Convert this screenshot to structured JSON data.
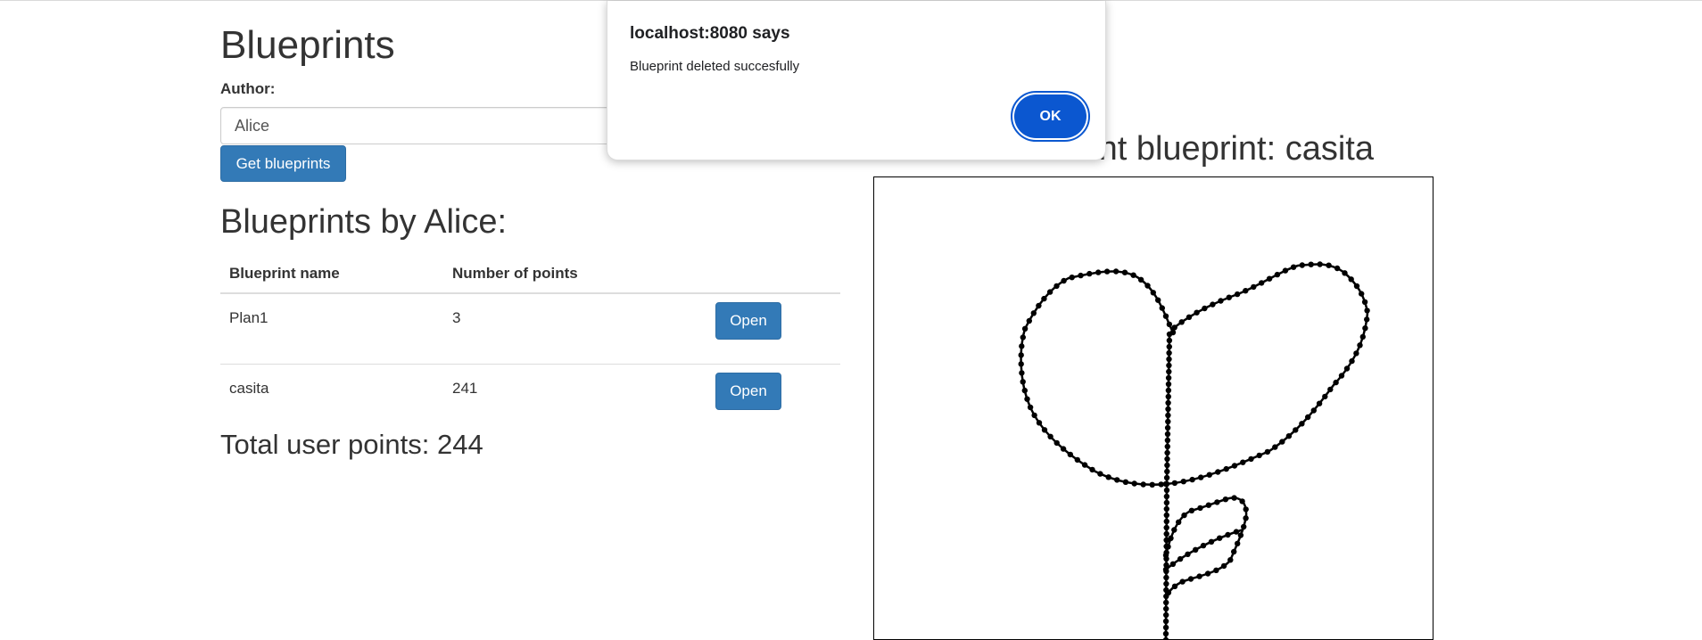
{
  "page": {
    "title": "Blueprints"
  },
  "author": {
    "label": "Author:",
    "value": "Alice"
  },
  "get_button": {
    "label": "Get blueprints"
  },
  "section": {
    "title": "Blueprints by Alice:"
  },
  "table": {
    "headers": [
      "Blueprint name",
      "Number of points"
    ],
    "rows": [
      {
        "name": "Plan1",
        "points": "3",
        "action": "Open"
      },
      {
        "name": "casita",
        "points": "241",
        "action": "Open"
      }
    ]
  },
  "total": {
    "text": "Total user points: 244"
  },
  "canvas": {
    "title": "Current blueprint: casita"
  },
  "dialog": {
    "title": "localhost:8080 says",
    "message": "Blueprint deleted succesfully",
    "ok_label": "OK"
  },
  "colors": {
    "primary_button": "#337ab7",
    "dialog_button": "#0b57d0"
  }
}
